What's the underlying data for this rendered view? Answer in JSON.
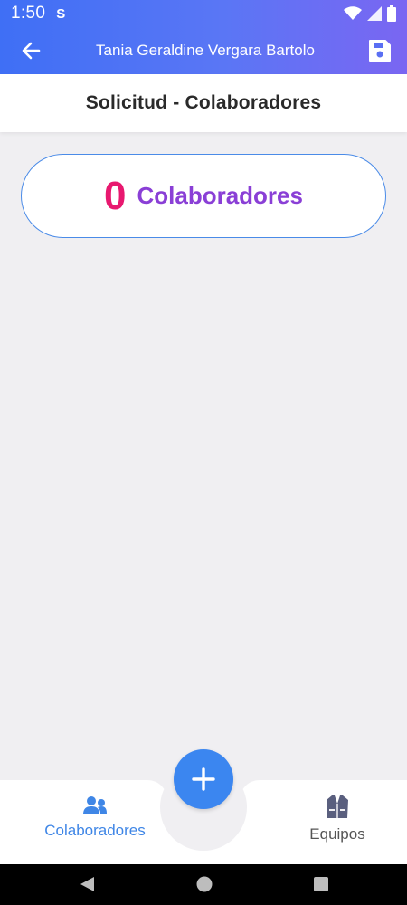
{
  "status_bar": {
    "time": "1:50",
    "notification_icon": "S"
  },
  "toolbar": {
    "title": "Tania Geraldine Vergara Bartolo"
  },
  "section": {
    "title": "Solicitud - Colaboradores"
  },
  "counter": {
    "count": "0",
    "label": "Colaboradores"
  },
  "bottom_nav": {
    "items": [
      {
        "label": "Colaboradores",
        "icon": "users-icon",
        "active": true
      },
      {
        "label": "Equipos",
        "icon": "vest-icon",
        "active": false
      }
    ],
    "fab_icon": "plus-icon"
  },
  "colors": {
    "header_gradient_start": "#3f6ff5",
    "header_gradient_end": "#7a66f2",
    "counter_number": "#e8186f",
    "counter_label": "#8a3fd6",
    "accent_blue": "#3b86f0",
    "background": "#f0eff2"
  }
}
